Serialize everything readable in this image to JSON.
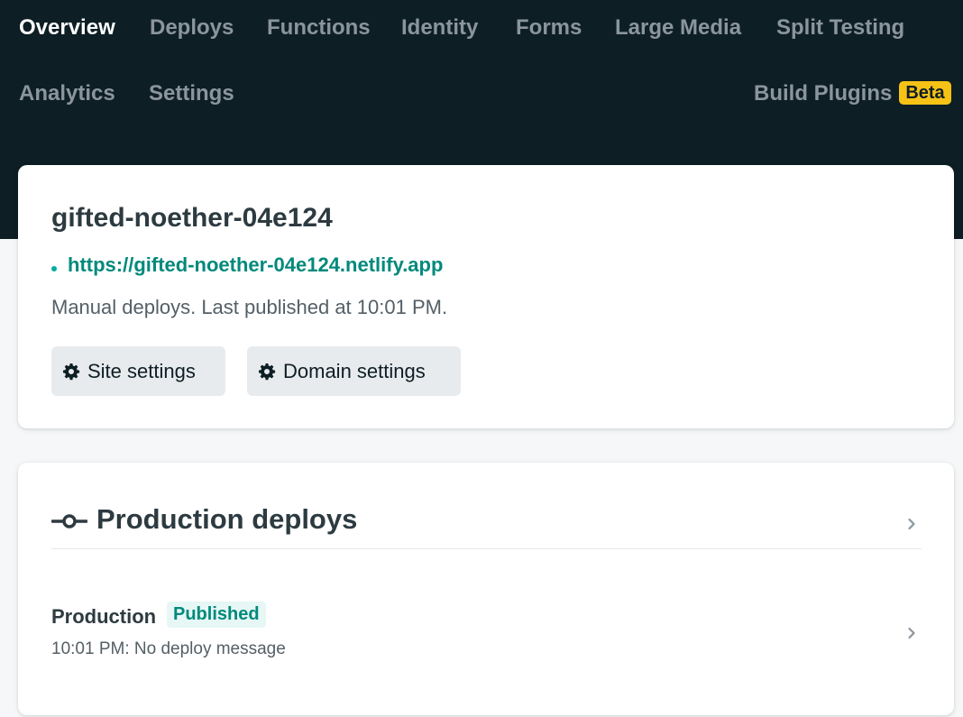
{
  "nav": {
    "items": [
      {
        "label": "Overview",
        "active": true
      },
      {
        "label": "Deploys"
      },
      {
        "label": "Functions"
      },
      {
        "label": "Identity"
      },
      {
        "label": "Forms"
      },
      {
        "label": "Large Media"
      },
      {
        "label": "Split Testing"
      },
      {
        "label": "Analytics"
      },
      {
        "label": "Settings"
      }
    ],
    "build_plugins": {
      "label": "Build Plugins",
      "badge": "Beta"
    }
  },
  "site": {
    "name": "gifted-noether-04e124",
    "url": "https://gifted-noether-04e124.netlify.app",
    "description": "Manual deploys. Last published at 10:01 PM.",
    "buttons": {
      "site_settings": "Site settings",
      "domain_settings": "Domain settings"
    }
  },
  "production": {
    "title": "Production deploys",
    "row": {
      "label": "Production",
      "badge": "Published",
      "meta": "10:01 PM: No deploy message"
    }
  },
  "colors": {
    "header_bg": "#0e1e25",
    "accent": "#00897b",
    "beta_badge": "#f6c216"
  },
  "icons": [
    "gear-icon",
    "commit-icon",
    "chevron-right-icon"
  ]
}
